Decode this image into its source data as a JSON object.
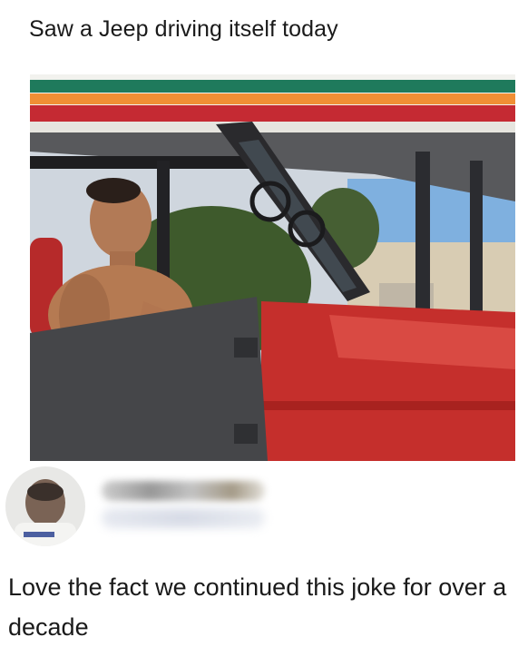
{
  "post": {
    "caption": "Saw a Jeep driving itself today"
  },
  "comment": {
    "text": "Love the fact we continued this joke for over a decade"
  }
}
